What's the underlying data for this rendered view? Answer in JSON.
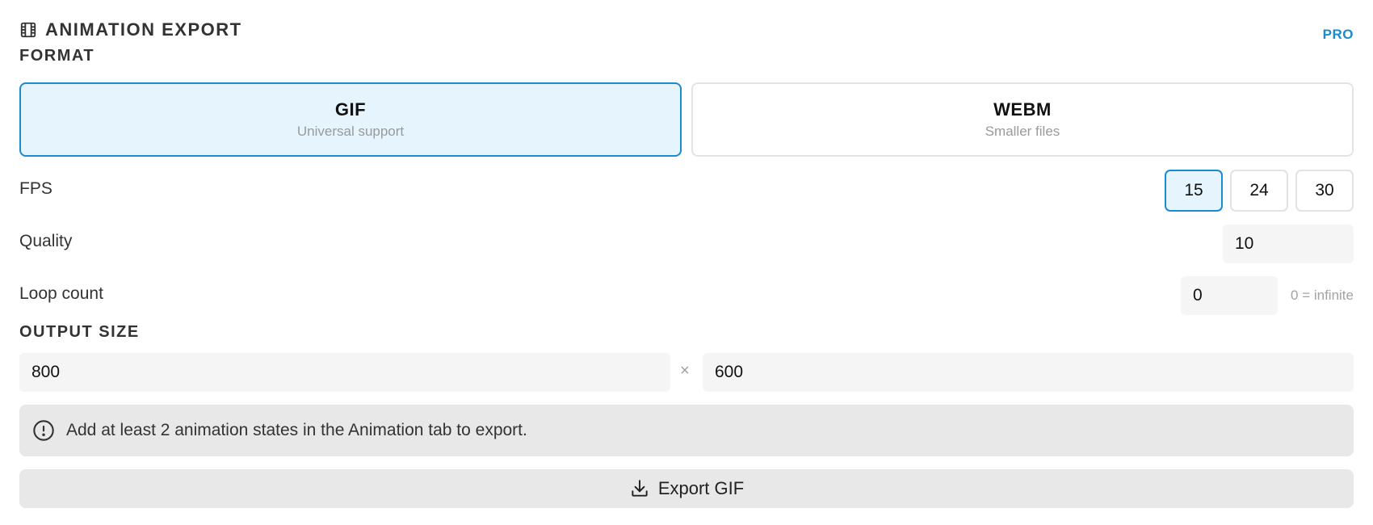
{
  "header": {
    "title": "ANIMATION EXPORT",
    "icon": "film-icon",
    "badge": "PRO"
  },
  "format": {
    "section_label": "FORMAT",
    "options": [
      {
        "name": "GIF",
        "description": "Universal support",
        "selected": true
      },
      {
        "name": "WEBM",
        "description": "Smaller files",
        "selected": false
      }
    ]
  },
  "fps": {
    "label": "FPS",
    "options": [
      "15",
      "24",
      "30"
    ],
    "selected": "15"
  },
  "quality": {
    "label": "Quality",
    "value": "10"
  },
  "loop": {
    "label": "Loop count",
    "value": "0",
    "hint": "0 = infinite"
  },
  "output_size": {
    "section_label": "OUTPUT SIZE",
    "width": "800",
    "separator": "×",
    "height": "600"
  },
  "notice": {
    "icon": "alert-circle-icon",
    "text": "Add at least 2 animation states in the Animation tab to export."
  },
  "export": {
    "icon": "download-icon",
    "label": "Export GIF"
  },
  "colors": {
    "accent": "#1a8bd0",
    "selected_bg": "#e6f4fd"
  }
}
